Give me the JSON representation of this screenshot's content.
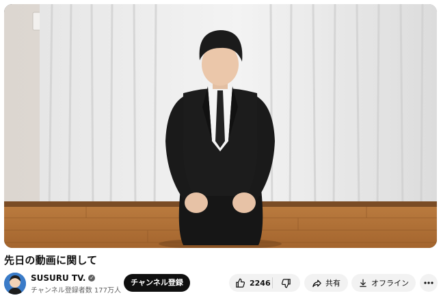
{
  "video": {
    "thumbnail_icon": "video-frame-kneeling-man-in-suit"
  },
  "title": "先日の動画に関して",
  "channel": {
    "avatar_icon": "channel-avatar",
    "name": "SUSURU TV.",
    "verified_icon": "verified-check-icon",
    "subscribers": "チャンネル登録者数 177万人"
  },
  "actions": {
    "subscribe_label": "チャンネル登録",
    "like_count": "2246",
    "like_icon": "thumbs-up-icon",
    "dislike_icon": "thumbs-down-icon",
    "share_label": "共有",
    "share_icon": "share-arrow-icon",
    "download_label": "オフライン",
    "download_icon": "download-icon",
    "more_icon": "more-horizontal-icon"
  },
  "colors": {
    "subscribe_bg": "#0f0f0f",
    "pill_bg": "#f2f2f2",
    "secondary_text": "#606060"
  }
}
